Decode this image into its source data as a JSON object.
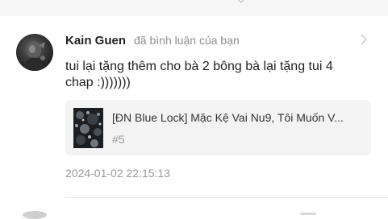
{
  "comment": {
    "user_name": "Kain Guen",
    "action_text": "đã bình luận của bạn",
    "text": "tui lại tặng thêm cho bà 2 bông bà lại tặng tui 4 chap :)))))))",
    "timestamp": "2024-01-02 22:15:13",
    "avatar_icon": "user-avatar",
    "chapter": {
      "story_title": "[ĐN Blue Lock] Mặc Kệ Vai Nu9, Tôi Muốn V...",
      "chapter_number": "#5",
      "thumbnail_icon": "story-cover-thumbnail"
    }
  },
  "icons": {
    "more": "chevron-right-icon",
    "top": "chevron-down-icon"
  },
  "colors": {
    "background": "#ffffff",
    "card_background": "#f3f3f3",
    "muted_text": "#9a9a9a",
    "primary_text": "#222222"
  }
}
